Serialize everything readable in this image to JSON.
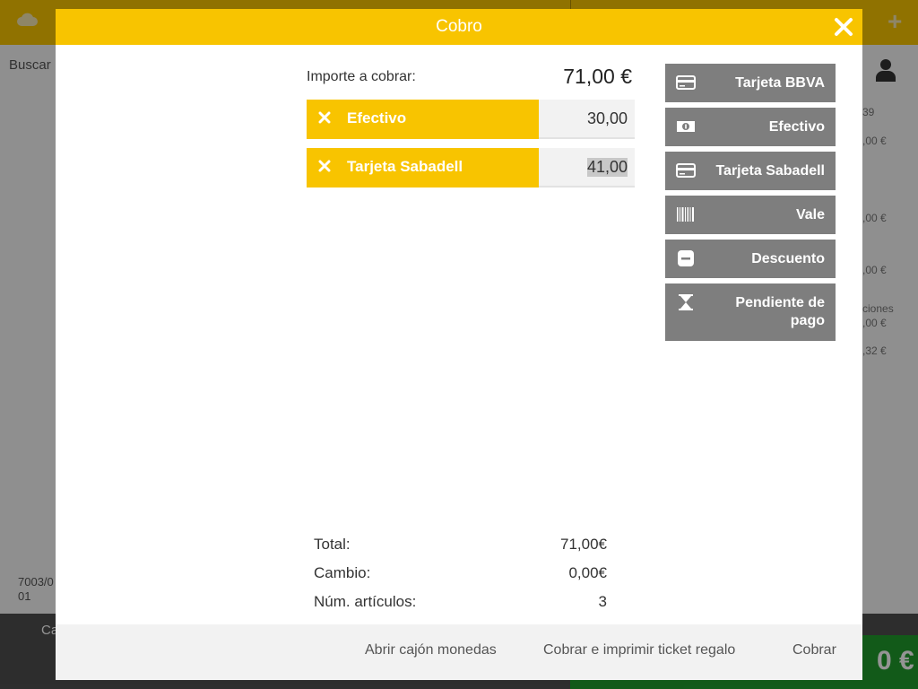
{
  "background": {
    "search_text": "Buscar",
    "right_texts": [
      "39",
      ",00 €",
      ",00 €",
      ",00 €",
      "ciones",
      ",00 €",
      ",32 €"
    ],
    "ref_line1": "7003/0",
    "ref_line2": "01",
    "bottom_left_label": "Ca",
    "bottom_right_currency": "0 €"
  },
  "modal": {
    "title": "Cobro",
    "amount_label": "Importe a cobrar:",
    "amount_value": "71,00 €",
    "payments": [
      {
        "label": "Efectivo",
        "amount": "30,00"
      },
      {
        "label": "Tarjeta Sabadell",
        "amount": "41,00"
      }
    ],
    "methods": [
      {
        "label": "Tarjeta BBVA",
        "icon": "credit-card-icon"
      },
      {
        "label": "Efectivo",
        "icon": "banknote-icon"
      },
      {
        "label": "Tarjeta Sabadell",
        "icon": "credit-card-icon"
      },
      {
        "label": "Vale",
        "icon": "barcode-icon"
      },
      {
        "label": "Descuento",
        "icon": "minus-icon"
      },
      {
        "label": "Pendiente de pago",
        "icon": "hourglass-icon"
      }
    ],
    "summary": {
      "total_label": "Total:",
      "total_value": "71,00€",
      "change_label": "Cambio:",
      "change_value": "0,00€",
      "items_label": "Núm. artículos:",
      "items_value": "3"
    },
    "footer": {
      "open_drawer": "Abrir cajón monedas",
      "charge_gift": "Cobrar e imprimir ticket regalo",
      "charge": "Cobrar"
    }
  },
  "colors": {
    "accent": "#f8c400",
    "method_button": "#7e7e7e",
    "confirm_green": "#1f9c2c"
  }
}
